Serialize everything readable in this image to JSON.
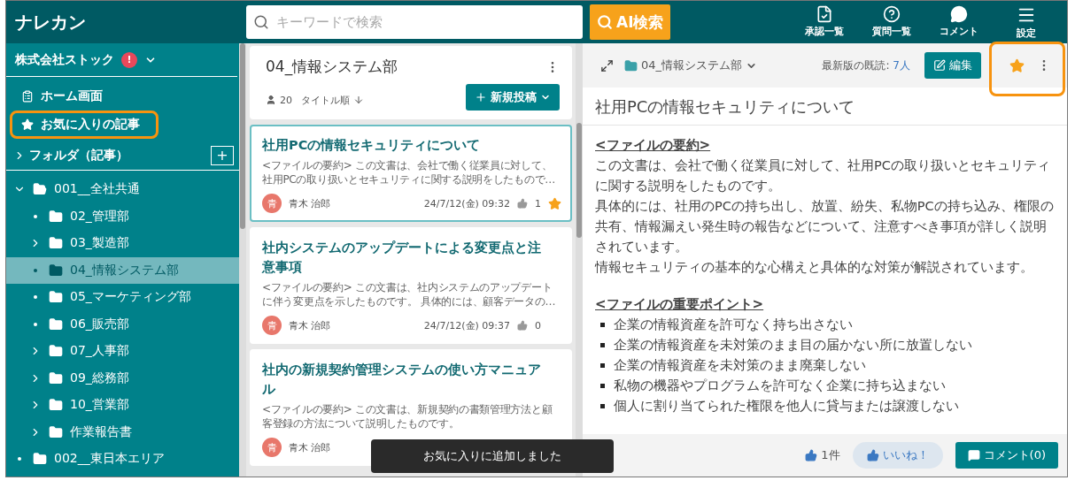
{
  "header": {
    "logo": "ナレカン",
    "search": {
      "placeholder": "キーワードで検索"
    },
    "ai_button": "AI検索",
    "nav": [
      {
        "kind": "approval",
        "label": "承認一覧"
      },
      {
        "kind": "question",
        "label": "質問一覧"
      },
      {
        "kind": "comment",
        "label": "コメント"
      },
      {
        "kind": "menu",
        "label": "設定"
      }
    ]
  },
  "sidebar": {
    "company": "株式会社ストック",
    "alert": "!",
    "items": [
      {
        "kind": "home",
        "label": "ホーム画面",
        "highlighted": false
      },
      {
        "kind": "favorite",
        "label": "お気に入りの記事",
        "highlighted": true
      }
    ],
    "folders_label": "フォルダ（記事）",
    "add": "+",
    "tree": [
      {
        "label": "001__全社共通",
        "expandable": true,
        "expanded": true,
        "selected": false,
        "children": [
          {
            "label": "02_管理部",
            "expandable": false,
            "expanded": false,
            "selected": false
          },
          {
            "label": "03_製造部",
            "expandable": true,
            "expanded": false,
            "selected": false
          },
          {
            "label": "04_情報システム部",
            "expandable": false,
            "expanded": false,
            "selected": true
          },
          {
            "label": "05_マーケティング部",
            "expandable": false,
            "expanded": false,
            "selected": false
          },
          {
            "label": "06_販売部",
            "expandable": false,
            "expanded": false,
            "selected": false
          },
          {
            "label": "07_人事部",
            "expandable": true,
            "expanded": false,
            "selected": false
          },
          {
            "label": "09_総務部",
            "expandable": true,
            "expanded": false,
            "selected": false
          },
          {
            "label": "10_営業部",
            "expandable": true,
            "expanded": false,
            "selected": false
          },
          {
            "label": "作業報告書",
            "expandable": true,
            "expanded": false,
            "selected": false
          }
        ]
      },
      {
        "label": "002__東日本エリア",
        "expandable": false,
        "expanded": false,
        "selected": false
      }
    ]
  },
  "list": {
    "folder": "04_情報システム部",
    "members": "20",
    "sort": "タイトル順",
    "new_post": "新規投稿",
    "articles": [
      {
        "title": "社用PCの情報セキュリティについて",
        "summary": [
          "<ファイルの要約> この文書は、会社で働く従業員に対して、",
          "社用PCの取り扱いとセキュリティに関する説明をしたもので…"
        ],
        "avatar": "青",
        "author": "青木 治郎",
        "date": "24/7/12(金) 09:32",
        "likes": "1",
        "favorite": true,
        "selected": true
      },
      {
        "title": "社内システムのアップデートによる変更点と注意事項",
        "summary": [
          "<ファイルの要約> この文書は、社内システムのアップデート",
          "に伴う変更点を示したものです。 具体的には、顧客データの…"
        ],
        "avatar": "青",
        "author": "青木 治郎",
        "date": "24/7/12(金) 09:37",
        "likes": "0",
        "favorite": false,
        "selected": false
      },
      {
        "title": "社内の新規契約管理システムの使い方マニュアル",
        "summary": [
          "<ファイルの要約> この文書は、新規契約の書類管理方法と顧",
          "客登録の方法について説明したものです。"
        ],
        "avatar": "青",
        "author": "青木 治郎",
        "favorite": false,
        "selected": false
      }
    ]
  },
  "detail": {
    "path": "04_情報システム部",
    "read_label": "最新版の既読:",
    "read_count": "7人",
    "edit": "編集",
    "favorite": true,
    "title": "社用PCの情報セキュリティについて",
    "blocks": [
      {
        "kind": "heading",
        "text": "<ファイルの要約>"
      },
      {
        "kind": "paragraph",
        "text": "この文書は、会社で働く従業員に対して、社用PCの取り扱いとセキュリティに関する説明をしたものです。"
      },
      {
        "kind": "paragraph",
        "text": "具体的には、社用のPCの持ち出し、放置、紛失、私物PCの持ち込み、権限の共有、情報漏えい発生時の報告などについて、注意すべき事項が詳しく説明されています。"
      },
      {
        "kind": "paragraph",
        "text": "情報セキュリティの基本的な心構えと具体的な対策が解説されています。"
      },
      {
        "kind": "spacer"
      },
      {
        "kind": "heading",
        "text": "<ファイルの重要ポイント>"
      },
      {
        "kind": "bullet",
        "text": "企業の情報資産を許可なく持ち出さない"
      },
      {
        "kind": "bullet",
        "text": "企業の情報資産を未対策のまま目の届かない所に放置しない"
      },
      {
        "kind": "bullet",
        "text": "企業の情報資産を未対策のまま廃棄しない"
      },
      {
        "kind": "bullet",
        "text": "私物の機器やプログラムを許可なく企業に持ち込まない"
      },
      {
        "kind": "bullet",
        "text": "個人に割り当てられた権限を他人に貸与または譲渡しない"
      }
    ],
    "like_count": "1件",
    "like_button": "いいね！",
    "comment_button": "コメント(0)"
  },
  "toast": "お気に入りに追加しました"
}
